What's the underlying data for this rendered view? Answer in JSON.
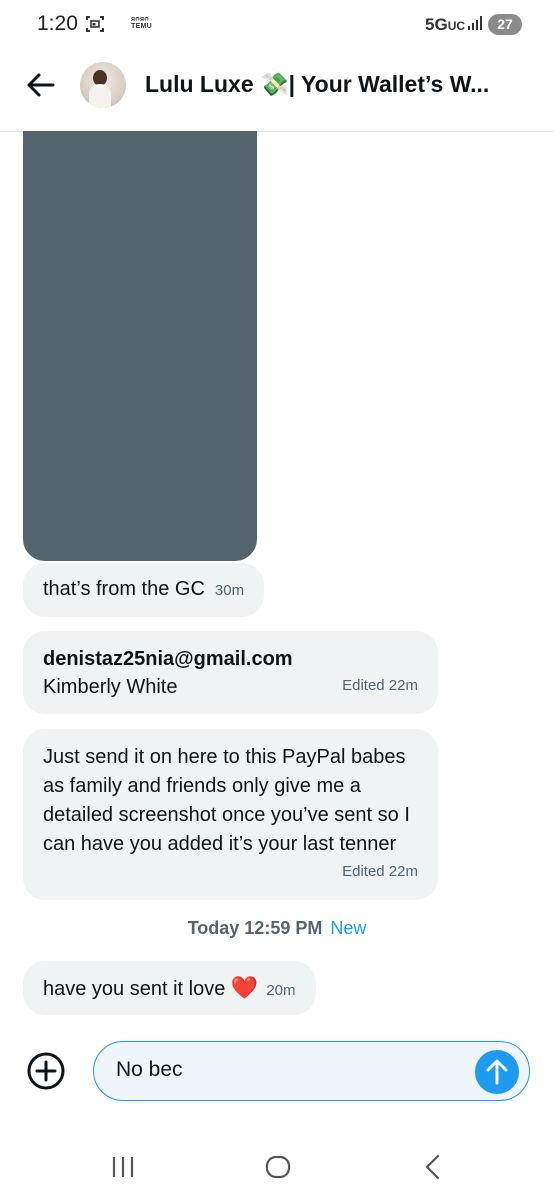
{
  "status_bar": {
    "time": "1:20",
    "app_badge_line1": "ᴙᴒᴙᴒ",
    "app_badge_line2": "TEMU",
    "network": "5G",
    "network_suffix": "UC",
    "battery": "27"
  },
  "header": {
    "title": "Lulu Luxe 💸| Your Wallet’s W..."
  },
  "messages": [
    {
      "text": "that’s from the GC",
      "time": "30m"
    },
    {
      "email": "denistaz25nia@gmail.com",
      "name": "Kimberly White",
      "time": "Edited 22m"
    },
    {
      "text": "Just send it on here to this PayPal babes as family and friends only give me a detailed screenshot once you’ve sent so I can have you added it’s your last tenner",
      "time": "Edited 22m"
    },
    {
      "text": "have you sent it love",
      "emoji": "❤️",
      "time": "20m"
    }
  ],
  "divider": {
    "date": "Today 12:59 PM",
    "new_label": "New"
  },
  "composer": {
    "value": "No bec"
  },
  "colors": {
    "accent": "#1d9bf0",
    "bubble": "#eff3f4",
    "image_placeholder": "#53646f"
  },
  "icons": [
    "back-arrow-icon",
    "plus-circle-icon",
    "send-arrow-icon",
    "nav-recent-icon",
    "nav-home-icon",
    "nav-back-icon"
  ]
}
